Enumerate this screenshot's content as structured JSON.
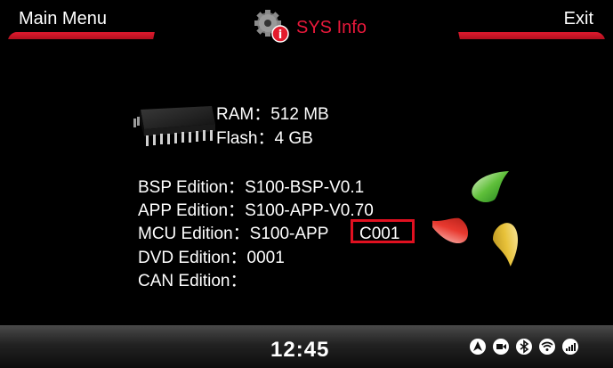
{
  "header": {
    "main_menu_label": "Main Menu",
    "title": "SYS Info",
    "exit_label": "Exit"
  },
  "memory": {
    "ram_label": "RAM：",
    "ram_value": "512 MB",
    "flash_label": "Flash：",
    "flash_value": "4 GB"
  },
  "editions": [
    {
      "label": "BSP Edition：",
      "value": "S100-BSP-V0.1"
    },
    {
      "label": "APP Edition：",
      "value": "S100-APP-V0.70"
    },
    {
      "label": "MCU Edition：",
      "value": "S100-APP"
    },
    {
      "label": "DVD Edition：",
      "value": "0001"
    },
    {
      "label": "CAN Edition：",
      "value": ""
    }
  ],
  "mcu_highlighted_value": "C001",
  "footer": {
    "clock": "12:45",
    "status_icons": [
      "navigation-icon",
      "camera-icon",
      "bluetooth-icon",
      "wifi-icon",
      "cellular-3g-icon"
    ]
  },
  "colors": {
    "accent": "#e01a2e",
    "title": "#e8193b",
    "background": "#000000",
    "highlight": "#e01020"
  }
}
